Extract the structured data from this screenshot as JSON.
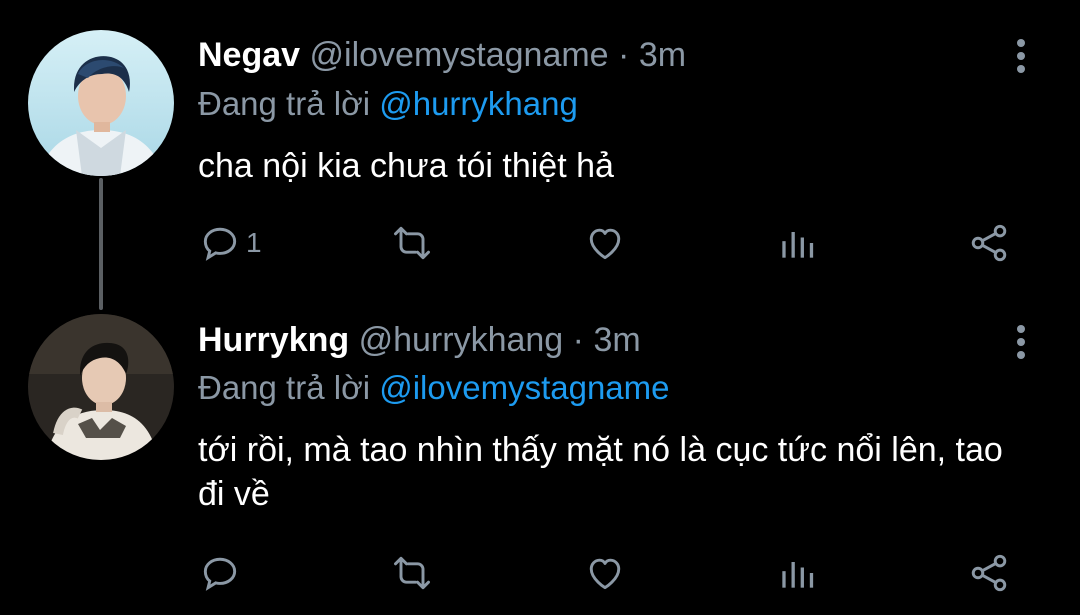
{
  "colors": {
    "background": "#000000",
    "text": "#ffffff",
    "secondary": "#8b98a5",
    "mention": "#1d9bf0"
  },
  "tweets": [
    {
      "name": "Negav",
      "handle": "@ilovemystagname",
      "separator": "·",
      "time": "3m",
      "reply_prefix": "Đang trả lời",
      "reply_to": "@hurrykhang",
      "text": "cha nội kia chưa tói thiệt hả",
      "reply_count": "1",
      "icons": [
        "reply-icon",
        "retweet-icon",
        "like-icon",
        "views-icon",
        "share-icon",
        "more-icon"
      ]
    },
    {
      "name": "Hurrykng",
      "handle": "@hurrykhang",
      "separator": "·",
      "time": "3m",
      "reply_prefix": "Đang trả lời",
      "reply_to": "@ilovemystagname",
      "text": "tới rồi, mà tao nhìn thấy mặt nó là cục tức nổi lên, tao đi về",
      "reply_count": "",
      "icons": [
        "reply-icon",
        "retweet-icon",
        "like-icon",
        "views-icon",
        "share-icon",
        "more-icon"
      ]
    }
  ]
}
